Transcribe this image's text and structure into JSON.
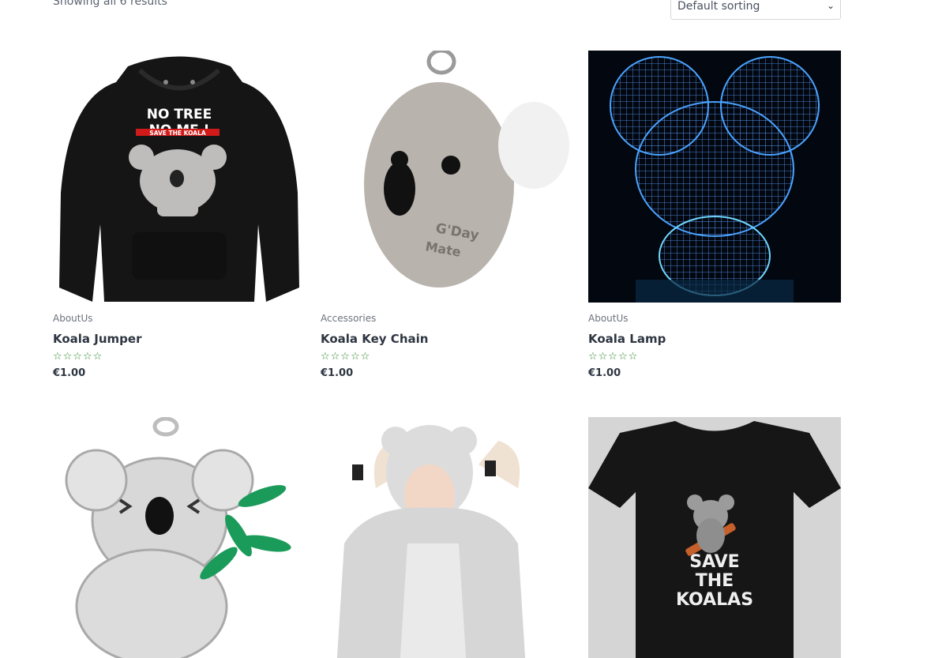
{
  "toolbar": {
    "result_count": "Showing all 6 results",
    "sorting_value": "Default sorting"
  },
  "products": [
    {
      "category": "AboutUs",
      "title": "Koala Jumper",
      "price": "€1.00",
      "rating": 0,
      "image_text": [
        "NO TREE",
        "NO ME !",
        "SAVE THE KOALA"
      ]
    },
    {
      "category": "Accessories",
      "title": "Koala Key Chain",
      "price": "€1.00",
      "rating": 0,
      "image_text": [
        "G'Day",
        "Mate"
      ]
    },
    {
      "category": "AboutUs",
      "title": "Koala Lamp",
      "price": "€1.00",
      "rating": 0
    },
    {
      "category": "",
      "title": "",
      "price": "",
      "rating": 0
    },
    {
      "category": "",
      "title": "",
      "price": "",
      "rating": 0
    },
    {
      "category": "",
      "title": "",
      "price": "",
      "rating": 0,
      "image_text": [
        "SAVE",
        "THE",
        "KOALAS"
      ]
    }
  ],
  "stars_glyphs": "☆☆☆☆☆",
  "colors": {
    "star": "#2e8b2e",
    "text": "#2e3642",
    "muted": "#6c737d"
  }
}
